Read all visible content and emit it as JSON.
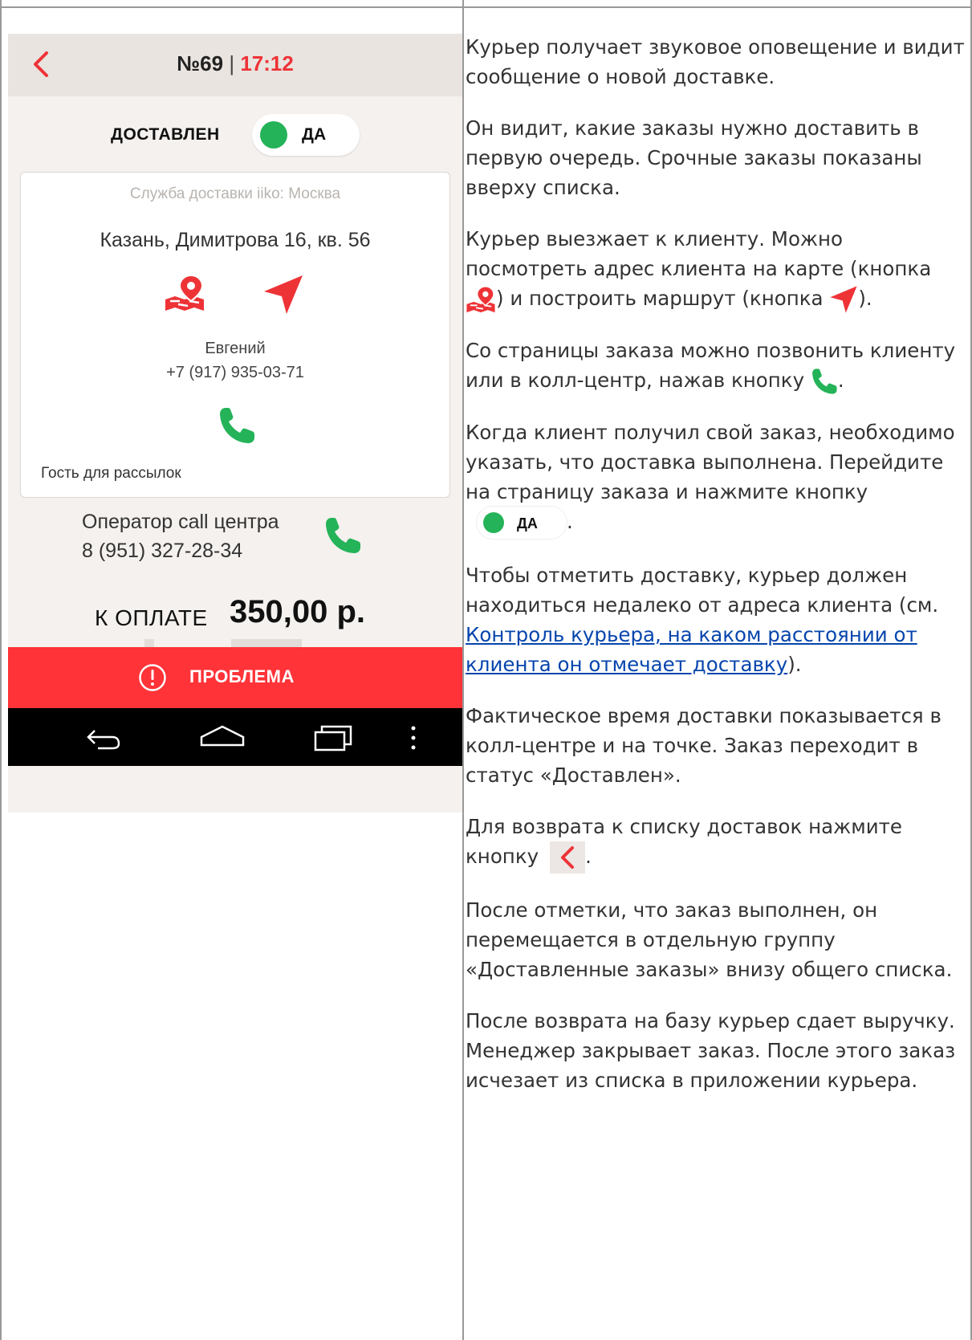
{
  "colors": {
    "accent_red": "#ee3337",
    "problem_bar": "#ff3338",
    "success_green": "#24b358",
    "link_blue": "#0645ad"
  },
  "phone": {
    "header": {
      "order_number": "№69",
      "separator": "|",
      "time": "17:12"
    },
    "delivered": {
      "label": "ДОСТАВЛЕН",
      "toggle_value": "ДА"
    },
    "card": {
      "service": "Служба доставки iiko: Москва",
      "address": "Казань, Димитрова 16, кв. 56",
      "customer_name": "Евгений",
      "customer_phone": "+7 (917) 935-03-71",
      "guest_note": "Гость для рассылок"
    },
    "operator": {
      "label": "Оператор call центра",
      "phone": "8 (951) 327-28-34"
    },
    "payment": {
      "label": "К ОПЛАТЕ",
      "value": "350,00 р."
    },
    "problem_button": "ПРОБЛЕМА",
    "icons": {
      "back": "back-arrow-icon",
      "map": "map-pin-icon",
      "navigate": "navigation-arrow-icon",
      "call": "phone-icon",
      "problem": "exclamation-circle-icon"
    }
  },
  "doc": {
    "p1": "Курьер получает звуковое оповещение и видит сообщение о новой доставке.",
    "p2": "Он видит, какие заказы нужно доставить в первую очередь. Срочные заказы показаны вверху списка.",
    "p3_a": "Курьер выезжает к клиенту. Можно посмотреть адрес клиента на карте (кнопка ",
    "p3_b": ") и построить маршрут (кнопка ",
    "p3_c": ").",
    "p4_a": "Со страницы заказа можно позвонить клиенту или в колл-центр, нажав кнопку ",
    "p4_b": ".",
    "p5_a": "Когда клиент получил свой заказ, необходимо указать, что доставка выполнена. Перейдите на страницу заказа и нажмите кнопку",
    "p5_toggle": "ДА",
    "p5_b": ".",
    "p6_a": "Чтобы отметить доставку, курьер должен находиться недалеко от адреса клиента (см. ",
    "p6_link": "Контроль курьера, на каком расстоянии от клиента он отмечает доставку",
    "p6_b": ").",
    "p7": "Фактическое время доставки показывается в колл-центре и на точке. Заказ переходит в статус «Доставлен».",
    "p8_a": "Для возврата к списку доставок нажмите кнопку",
    "p8_b": ".",
    "p9": "После отметки, что заказ выполнен, он перемещается в отдельную группу «Доставленные заказы» внизу общего списка.",
    "p10": "После возврата на базу курьер сдает выручку. Менеджер закрывает заказ. После этого заказ исчезает из списка в приложении курьера."
  }
}
